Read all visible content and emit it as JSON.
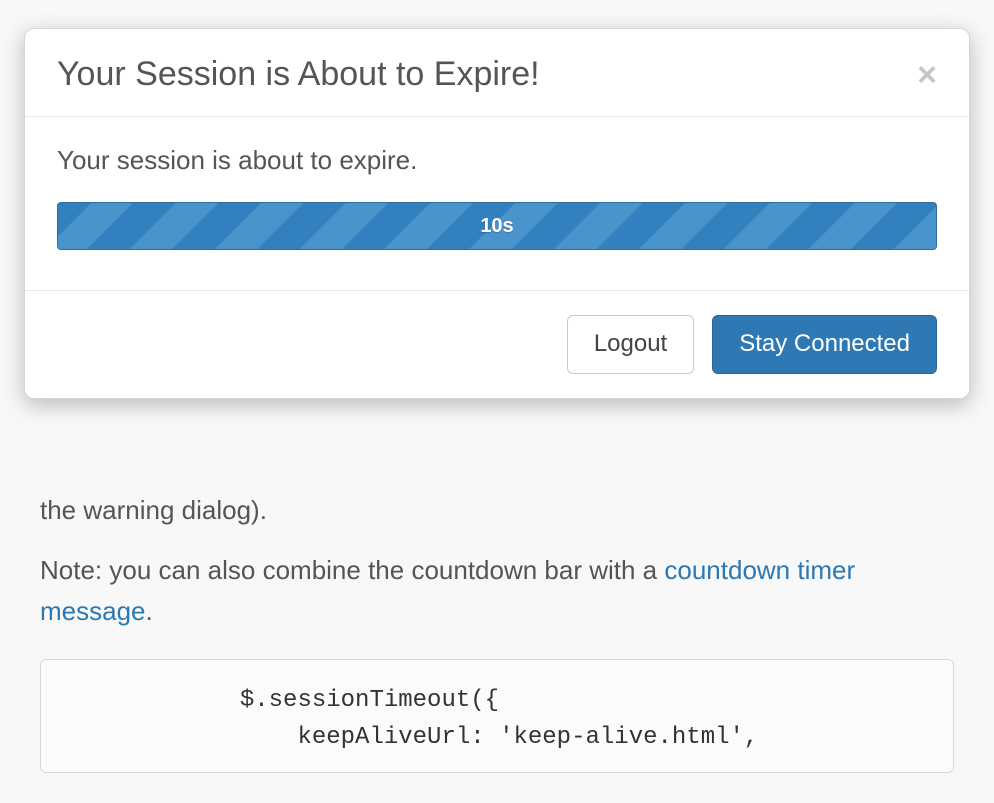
{
  "modal": {
    "title": "Your Session is About to Expire!",
    "close_glyph": "×",
    "message": "Your session is about to expire.",
    "progress_label": "10s",
    "logout_label": "Logout",
    "stay_label": "Stay Connected"
  },
  "background": {
    "fragment_text": "the warning dialog).",
    "note_prefix": "Note: you can also combine the countdown bar with a ",
    "note_link": "countdown timer message",
    "note_suffix": ".",
    "code_line1": "$.sessionTimeout({",
    "code_line2": "    keepAliveUrl: 'keep-alive.html',"
  }
}
